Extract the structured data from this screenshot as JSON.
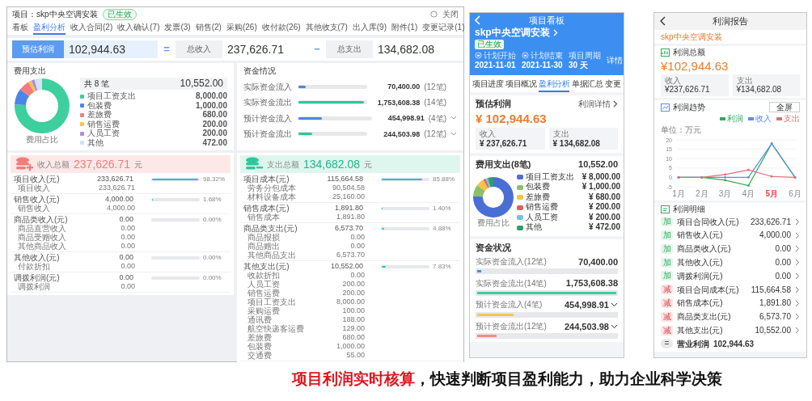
{
  "desktop": {
    "project": "项目：skp中央空调安装",
    "status": "已生效",
    "close": "关闭",
    "tabs": [
      {
        "label": "看板",
        "selected": false
      },
      {
        "label": "盈利分析",
        "selected": true
      },
      {
        "label": "收入合同(2)",
        "selected": false
      },
      {
        "label": "收入确认(7)",
        "selected": false
      },
      {
        "label": "发票(3)",
        "selected": false
      },
      {
        "label": "销售(2)",
        "selected": false
      },
      {
        "label": "采购(26)",
        "selected": false
      },
      {
        "label": "收付款(26)",
        "selected": false
      },
      {
        "label": "其他收支(7)",
        "selected": false
      },
      {
        "label": "出入库(9)",
        "selected": false
      },
      {
        "label": "附件(1)",
        "selected": false
      },
      {
        "label": "变更记录(1)",
        "selected": false
      }
    ],
    "summary": {
      "profit_label": "预估利润",
      "profit": "102,944.63",
      "equals": "=",
      "income_label": "总收入",
      "income": "237,626.71",
      "minus": "−",
      "expense_label": "总支出",
      "expense": "134,682.08"
    },
    "expense": {
      "title": "费用支出",
      "count_label": "共 8 笔",
      "total": "10,552.00",
      "caption": "费用占比",
      "legend": [
        {
          "amount": "8,000.00",
          "color": "#3ecf9e"
        },
        {
          "amount": "1,000.00",
          "color": "#4a86e8"
        },
        {
          "amount": "680.00",
          "color": "#f47c7c"
        },
        {
          "amount": "200.00",
          "color": "#f6c343"
        },
        {
          "amount": "200.00",
          "color": "#a98ee8"
        },
        {
          "amount": "472.00",
          "color": "#d4e2f4"
        }
      ],
      "chart_data": {
        "type": "donut",
        "categories": [
          "项目工资支出",
          "包装费",
          "差旅费",
          "销售运费",
          "人员工资",
          "其他"
        ],
        "values": [
          75.81,
          9.48,
          6.44,
          1.9,
          1.9,
          4.47
        ]
      }
    },
    "funds": {
      "title": "资金情况",
      "rows": [
        {
          "label": "实际资金流入",
          "amount": "70,400.00",
          "count": "(12笔)",
          "level": 0.11,
          "color": "#4a86e8",
          "expandable": false
        },
        {
          "label": "实际资金流出",
          "amount": "1,753,608.38",
          "count": "(14笔)",
          "level": 0.96,
          "color": "#2ec79b",
          "expandable": false
        },
        {
          "label": "预计资金流入",
          "amount": "454,998.91",
          "count": "(4笔)",
          "level": 0.32,
          "color": "#4a86e8",
          "expandable": true
        },
        {
          "label": "预计资金流出",
          "amount": "244,503.98",
          "count": "(12笔)",
          "level": 0.2,
          "color": "#2ec79b",
          "expandable": true
        }
      ]
    },
    "income_card": {
      "title": "收入总额",
      "total": "237,626.71",
      "unit": "元",
      "groups": [
        {
          "name": "项目收入(元)",
          "amount": "233,626.71",
          "level": 0.98,
          "percent": "98.32%",
          "children": [
            {
              "name": "项目收入",
              "amount": "233,626.71"
            }
          ]
        },
        {
          "name": "销售收入(元)",
          "amount": "4,000.00",
          "level": 0.02,
          "percent": "1.68%",
          "children": [
            {
              "name": "销售收入",
              "amount": "4,000.00"
            }
          ]
        },
        {
          "name": "商品类收入(元)",
          "amount": "0.00",
          "level": 0,
          "percent": "0.00%",
          "children": [
            {
              "name": "商品直营收入",
              "amount": "0.00"
            },
            {
              "name": "商品受赠收入",
              "amount": "0.00"
            },
            {
              "name": "其他商品收入",
              "amount": "0.00"
            }
          ]
        },
        {
          "name": "其他收入(元)",
          "amount": "0.00",
          "level": 0,
          "percent": "0.00%",
          "children": [
            {
              "name": "付款折扣",
              "amount": "0.00"
            }
          ]
        },
        {
          "name": "调拨利润(元)",
          "amount": "0.00",
          "level": 0,
          "percent": "0.00%",
          "children": [
            {
              "name": "调拨利润",
              "amount": "0.00"
            }
          ]
        }
      ]
    },
    "expense_card": {
      "title": "支出总额",
      "total": "134,682.08",
      "unit": "元",
      "groups": [
        {
          "name": "项目成本(元)",
          "amount": "115,664.58",
          "level": 0.86,
          "percent": "85.88%",
          "children": [
            {
              "name": "劳务分包成本",
              "amount": "90,504.58"
            },
            {
              "name": "材料设备成本",
              "amount": "25,160.00"
            }
          ]
        },
        {
          "name": "销售成本(元)",
          "amount": "1,891.80",
          "level": 0.014,
          "percent": "1.40%",
          "children": [
            {
              "name": "销售成本",
              "amount": "1,891.80"
            }
          ]
        },
        {
          "name": "商品类支出(元)",
          "amount": "6,573.70",
          "level": 0.05,
          "percent": "4.88%",
          "children": [
            {
              "name": "商品报损",
              "amount": "0.00"
            },
            {
              "name": "商品赠出",
              "amount": "0.00"
            },
            {
              "name": "其他商品支出",
              "amount": "6,573.70"
            }
          ]
        },
        {
          "name": "其他支出(元)",
          "amount": "10,552.00",
          "level": 0.08,
          "percent": "7.83%",
          "children": [
            {
              "name": "收款折扣",
              "amount": "0.00"
            },
            {
              "name": "人员工资",
              "amount": "200.00"
            },
            {
              "name": "销售运费",
              "amount": "200.00"
            },
            {
              "name": "项目工资支出",
              "amount": "8,000.00"
            },
            {
              "name": "采购运费",
              "amount": "100.00"
            },
            {
              "name": "通讯费",
              "amount": "188.00"
            },
            {
              "name": "航空快递客运费",
              "amount": "129.00"
            },
            {
              "name": "差旅费",
              "amount": "680.00"
            },
            {
              "name": "包装费",
              "amount": "1,000.00"
            },
            {
              "name": "交通费",
              "amount": "55.00"
            }
          ]
        }
      ]
    }
  },
  "board": {
    "title": "项目看板",
    "project": "skp中央空调安装",
    "status": "已生效",
    "plan": [
      {
        "label": "计划开始",
        "value": "2021-11-01",
        "icon": true
      },
      {
        "label": "计划结束",
        "value": "2021-11-30",
        "icon": true
      },
      {
        "label": "项目周期",
        "value": "30 天",
        "icon": false
      }
    ],
    "details_link": "详情",
    "tabs": [
      {
        "label": "项目进度",
        "selected": false
      },
      {
        "label": "项目概况",
        "selected": false
      },
      {
        "label": "盈利分析",
        "selected": true
      },
      {
        "label": "单据汇总",
        "selected": false
      },
      {
        "label": "变更",
        "selected": false
      }
    ],
    "profit": {
      "title": "预估利润",
      "link": "利润详情",
      "amount": "¥ 102,944.63",
      "income_label": "收入",
      "income": "¥ 237,626.71",
      "expense_label": "支出",
      "expense": "¥ 134,682.08"
    },
    "expense": {
      "title": "费用支出(8笔)",
      "total": "10,552.00",
      "caption": "费用占比",
      "legend": [
        {
          "amount": "¥ 8,000.00",
          "color": "#4a6fd4"
        },
        {
          "amount": "¥ 1,000.00",
          "color": "#8cc06a"
        },
        {
          "amount": "¥ 680.00",
          "color": "#f6c343"
        },
        {
          "amount": "¥ 200.00",
          "color": "#e85b5b"
        },
        {
          "amount": "¥ 200.00",
          "color": "#6ec3e6"
        },
        {
          "amount": "¥ 472.00",
          "color": "#2e9e6a"
        }
      ],
      "chart_data": {
        "type": "donut",
        "categories": [
          "项目工资支出",
          "包装费",
          "差旅费",
          "销售运费",
          "人员工资",
          "其他"
        ],
        "values": [
          75.81,
          9.48,
          6.44,
          1.9,
          1.9,
          4.47
        ]
      }
    },
    "funds": {
      "title": "资金状况",
      "rows": [
        {
          "label": "实际资金流入(12笔)",
          "amount": "70,400.00",
          "level": 0.03,
          "color": "#4a90e2",
          "expandable": false
        },
        {
          "label": "实际资金流出(14笔)",
          "amount": "1,753,608.38",
          "level": 1,
          "color": "#3ecfa0",
          "expandable": false
        },
        {
          "label": "预计资金流入(4笔)",
          "amount": "454,998.91",
          "level": 0.26,
          "color": "#f2c94c",
          "expandable": true
        },
        {
          "label": "预计资金流出(12笔)",
          "amount": "244,503.98",
          "level": 0.14,
          "color": "#f28b8b",
          "expandable": true
        }
      ]
    }
  },
  "report": {
    "title": "利润报告",
    "project": "skp中央空调安装",
    "total": {
      "title": "利润总额",
      "amount": "¥102,944.63",
      "income_label": "收入",
      "income": "¥237,626.71",
      "expense_label": "支出",
      "expense": "¥134,682.08"
    },
    "trend": {
      "title": "利润趋势",
      "button": "全屏",
      "unit": "单位：万元",
      "chart_data": {
        "type": "line",
        "categories": [
          "1月",
          "2月",
          "3月",
          "4月",
          "5月",
          "6月"
        ],
        "ylim": [
          -5,
          20
        ],
        "yticks": [
          -5,
          0,
          5,
          10,
          15,
          20
        ],
        "series": [
          {
            "name": "利润",
            "color": "#2eaa5c",
            "values": [
              0,
              0,
              -1.5,
              -4.4,
              18,
              0
            ]
          },
          {
            "name": "收入",
            "color": "#5b8def",
            "values": [
              0,
              0,
              0,
              0,
              18,
              0
            ]
          },
          {
            "name": "支出",
            "color": "#e06c75",
            "values": [
              0,
              0,
              1.5,
              4,
              0.5,
              0
            ]
          }
        ],
        "grid": true
      },
      "month_marks": [
        {
          "selected": false
        },
        {
          "selected": false
        },
        {
          "selected": false
        },
        {
          "selected": false
        },
        {
          "selected": true
        },
        {
          "selected": false
        }
      ]
    },
    "details": {
      "title": "利润明细",
      "rows": [
        {
          "kind": "add",
          "badge": "加",
          "label": "项目合同收入(元)",
          "amount": "233,626.71"
        },
        {
          "kind": "add",
          "badge": "加",
          "label": "销售收入(元)",
          "amount": "4,000.00"
        },
        {
          "kind": "add",
          "badge": "加",
          "label": "商品类收入(元)",
          "amount": "0.00"
        },
        {
          "kind": "add",
          "badge": "加",
          "label": "其他收入(元)",
          "amount": "0.00"
        },
        {
          "kind": "add",
          "badge": "加",
          "label": "调拨利润(元)",
          "amount": "0.00"
        },
        {
          "kind": "subtract",
          "badge": "减",
          "label": "项目合同成本(元)",
          "amount": "115,664.58"
        },
        {
          "kind": "subtract",
          "badge": "减",
          "label": "销售成本(元)",
          "amount": "1,891.80"
        },
        {
          "kind": "subtract",
          "badge": "减",
          "label": "商品类支出(元)",
          "amount": "6,573.70"
        },
        {
          "kind": "subtract",
          "badge": "减",
          "label": "其他支出(元)",
          "amount": "10,552.00"
        },
        {
          "kind": "result",
          "badge": "=",
          "label": "营业利润",
          "amount": "102,944.63"
        }
      ]
    }
  },
  "caption": {
    "parts": [
      {
        "text": "项目利润实时核算",
        "highlight": true
      },
      {
        "text": "，快速判断项目盈利能力，助力企业科学决策",
        "highlight": false
      }
    ]
  }
}
